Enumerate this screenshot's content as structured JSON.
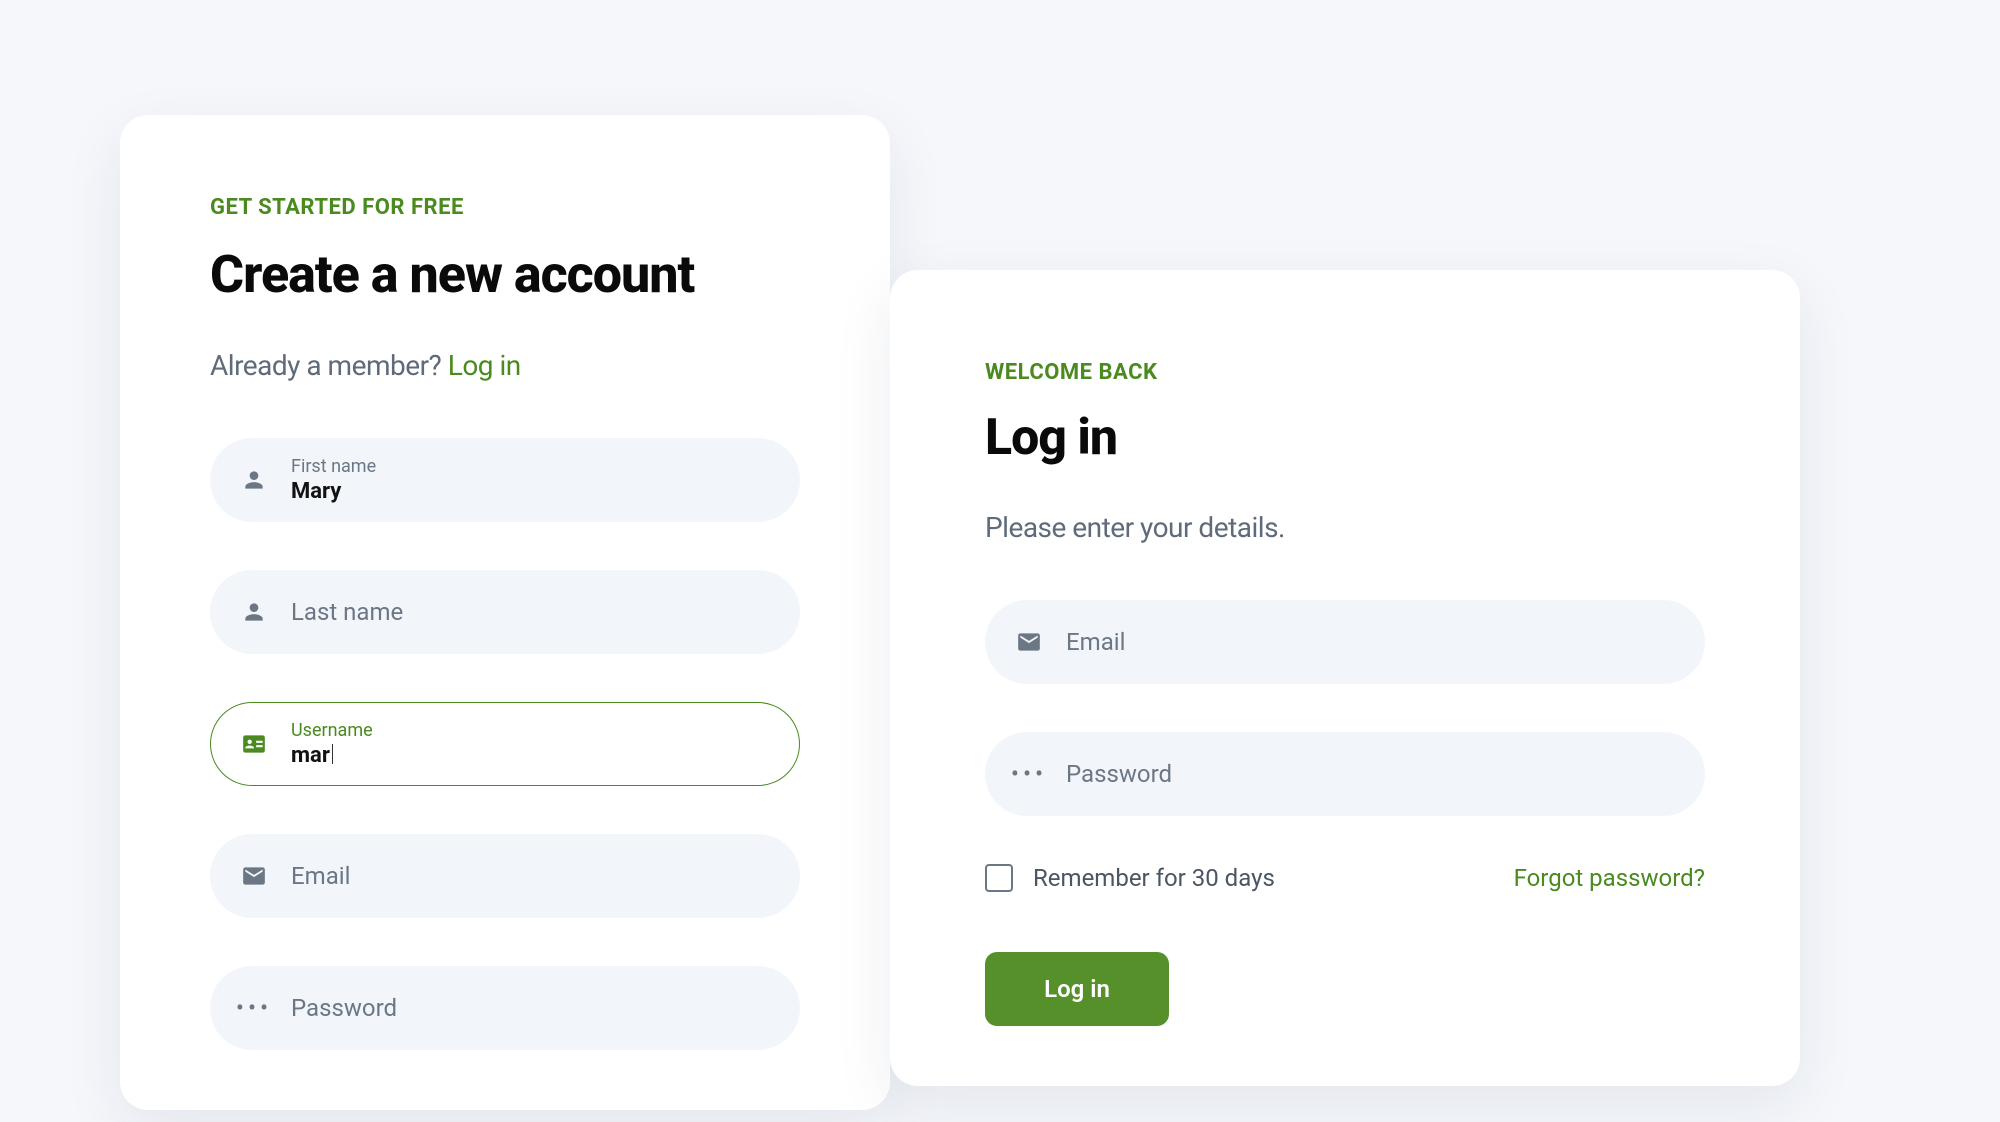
{
  "signup": {
    "overline": "GET STARTED FOR FREE",
    "heading": "Create a new account",
    "member_text": "Already a member?",
    "login_link": "Log in",
    "fields": {
      "first_name": {
        "label": "First name",
        "value": "Mary"
      },
      "last_name": {
        "placeholder": "Last name"
      },
      "username": {
        "label": "Username",
        "value": "mar"
      },
      "email": {
        "placeholder": "Email"
      },
      "password": {
        "placeholder": "Password"
      }
    }
  },
  "login": {
    "overline": "WELCOME BACK",
    "heading": "Log in",
    "subtitle": "Please enter your details.",
    "fields": {
      "email": {
        "placeholder": "Email"
      },
      "password": {
        "placeholder": "Password"
      }
    },
    "remember_label": "Remember for 30 days",
    "forgot_label": "Forgot password?",
    "submit_label": "Log in"
  }
}
